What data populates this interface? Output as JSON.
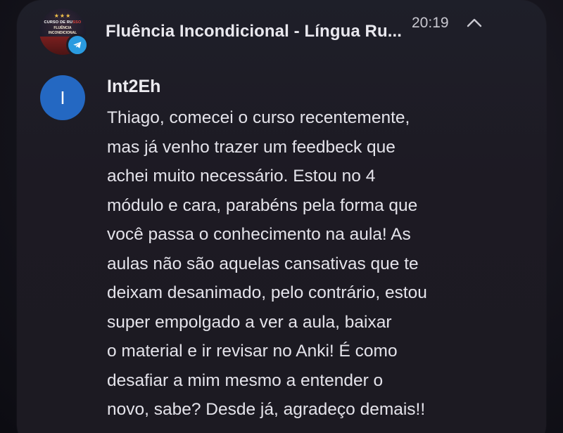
{
  "header": {
    "chat_title": "Fluência Incondicional - Língua Ru...",
    "time": "20:19",
    "avatar": {
      "line1": "CURSO DE RU",
      "line1_accent": "SSO",
      "line2": "FLUÊNCIA",
      "line3": "INCONDICIONAL"
    },
    "badge_icon": "telegram-icon",
    "collapse_icon": "chevron-up-icon"
  },
  "message": {
    "avatar_letter": "I",
    "sender": "Int2Eh",
    "lines": [
      "Thiago, comecei o curso recentemente,",
      "mas já venho trazer um feedbeck que",
      "achei muito necessário. Estou no 4",
      "módulo e cara, parabéns pela forma que",
      "você passa o conhecimento na aula! As",
      "aulas não são aquelas cansativas que te",
      "deixam desanimado, pelo contrário, estou",
      "super empolgado a ver a aula, baixar",
      "o material e ir revisar no Anki! É como",
      "desafiar a mim mesmo a entender o",
      "novo, sabe? Desde já, agradeço demais!!"
    ]
  },
  "colors": {
    "avatar_blue": "#2468c2",
    "telegram_blue": "#2a9be0",
    "text": "#e4e3ea"
  }
}
